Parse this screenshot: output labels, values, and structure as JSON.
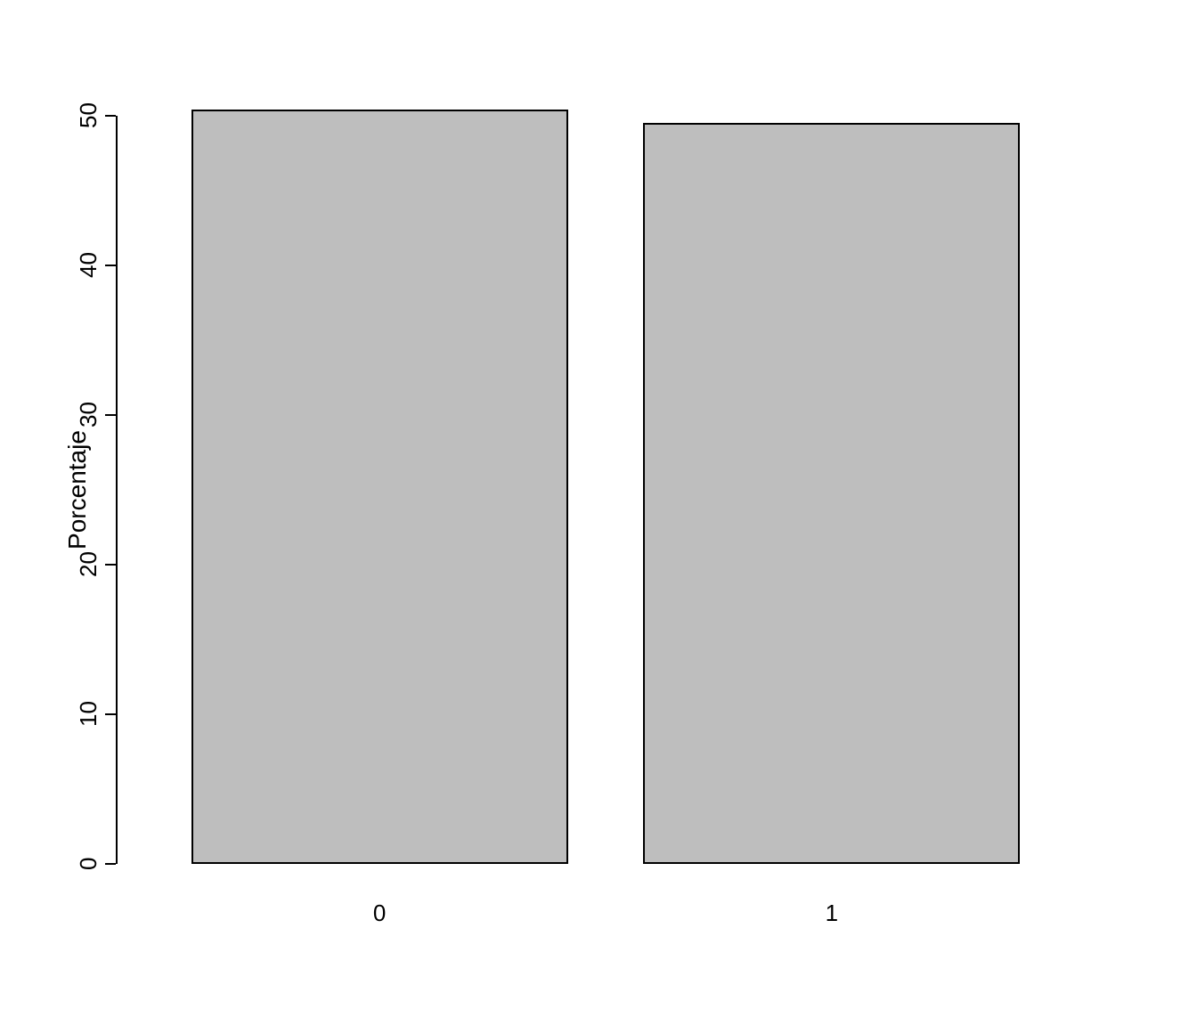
{
  "chart_data": {
    "type": "bar",
    "categories": [
      "0",
      "1"
    ],
    "values": [
      50.4,
      49.5
    ],
    "title": "",
    "xlabel": "",
    "ylabel": "Porcentaje",
    "ylim": [
      0,
      50
    ],
    "yticks": [
      0,
      10,
      20,
      30,
      40,
      50
    ],
    "bar_color": "#bebebe",
    "bar_border": "#000000"
  }
}
